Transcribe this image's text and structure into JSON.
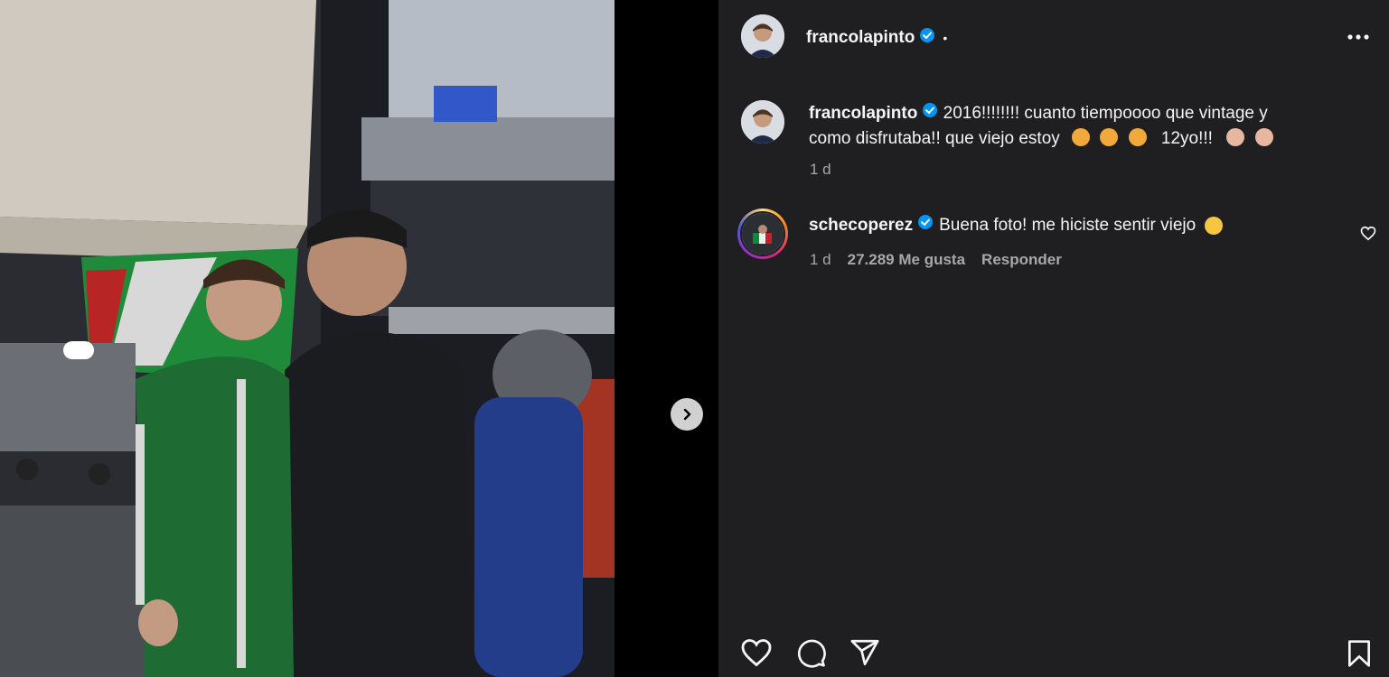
{
  "post": {
    "author": "francolapinto",
    "dot": "•",
    "more_icon": "more-horizontal-icon"
  },
  "caption": {
    "author": "francolapinto",
    "text_line1": "2016!!!!!!!! cuanto tiempoooo que vintage y",
    "text_line2_a": "como disfrutaba!! que viejo estoy",
    "text_line2_b": "12yo!!!",
    "emojis_a": [
      "persevering-face",
      "persevering-face",
      "persevering-face"
    ],
    "emojis_b": [
      "older-person",
      "older-person"
    ],
    "time": "1 d"
  },
  "comment": {
    "author": "schecoperez",
    "text": "Buena foto! me hiciste sentir viejo",
    "emoji": "laughing-face",
    "time": "1 d",
    "likes": "27.289 Me gusta",
    "reply": "Responder"
  },
  "actions": {
    "like_icon": "heart-icon",
    "comment_icon": "comment-icon",
    "share_icon": "share-icon",
    "save_icon": "bookmark-icon"
  },
  "colors": {
    "panel_bg": "#1f1f22",
    "text": "#f5f5f5",
    "muted": "#a8a8a8",
    "verified": "#0095f6"
  }
}
